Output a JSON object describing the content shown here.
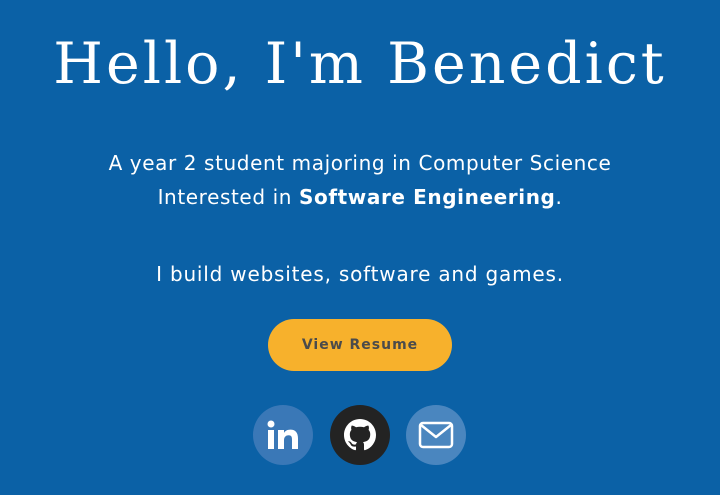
{
  "hero": {
    "title": "Hello, I'm Benedict",
    "intro_line_1": "A year 2 student majoring in Computer Science",
    "intro_line_2_prefix": "Interested in ",
    "intro_line_2_emphasis": "Software Engineering",
    "intro_line_2_suffix": ".",
    "build_text": "I build websites, software and games.",
    "resume_button_label": "View Resume"
  },
  "social_links": [
    {
      "icon": "linkedin-icon"
    },
    {
      "icon": "github-icon"
    },
    {
      "icon": "email-icon"
    }
  ],
  "colors": {
    "background": "#0b61a6",
    "resume_button": "#f7b12c",
    "linkedin_circle": "#3a78b7",
    "github_circle": "#232323",
    "email_circle": "#4a86bf"
  }
}
